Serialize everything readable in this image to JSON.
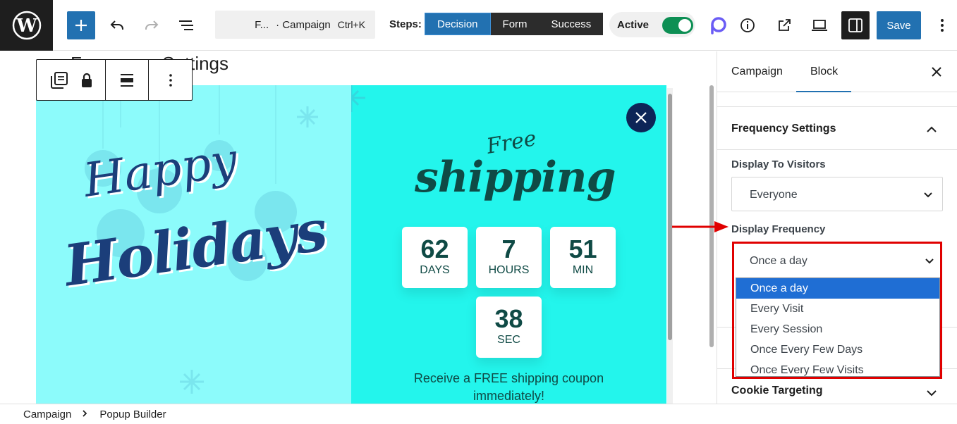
{
  "toolbar": {
    "command_title": "F...",
    "command_context": "· Campaign",
    "command_shortcut": "Ctrl+K",
    "steps_label": "Steps:",
    "steps": [
      {
        "label": "Decision",
        "active": true
      },
      {
        "label": "Form",
        "active": false
      },
      {
        "label": "Success",
        "active": false
      }
    ],
    "status_label": "Active",
    "status_on": true,
    "save_label": "Save"
  },
  "canvas": {
    "title": "Frequency Settings",
    "popup": {
      "left_line1": "Happy",
      "left_line2": "Holidays",
      "free_label": "Free",
      "headline": "shipping",
      "countdown": [
        {
          "value": "62",
          "unit": "DAYS"
        },
        {
          "value": "7",
          "unit": "HOURS"
        },
        {
          "value": "51",
          "unit": "MIN"
        },
        {
          "value": "38",
          "unit": "SEC"
        }
      ],
      "coupon_text": "Receive a FREE shipping coupon immediately!"
    }
  },
  "sidebar": {
    "tabs": [
      {
        "label": "Campaign",
        "active": false
      },
      {
        "label": "Block",
        "active": true
      }
    ],
    "panel_title": "Frequency Settings",
    "visitors_label": "Display To Visitors",
    "visitors_value": "Everyone",
    "frequency_label": "Display Frequency",
    "frequency_value": "Once a day",
    "frequency_options": [
      "Once a day",
      "Every Visit",
      "Every Session",
      "Once Every Few Days",
      "Once Every Few Visits"
    ],
    "next_panel_title": "Cookie Targeting"
  },
  "breadcrumb": [
    "Campaign",
    "Popup Builder"
  ],
  "colors": {
    "accent": "#2271b1",
    "highlight_red": "#e00000",
    "popup_left_bg": "#8cfbfb",
    "popup_right_bg": "#23f5ec",
    "toggle_on": "#0d8f54"
  }
}
